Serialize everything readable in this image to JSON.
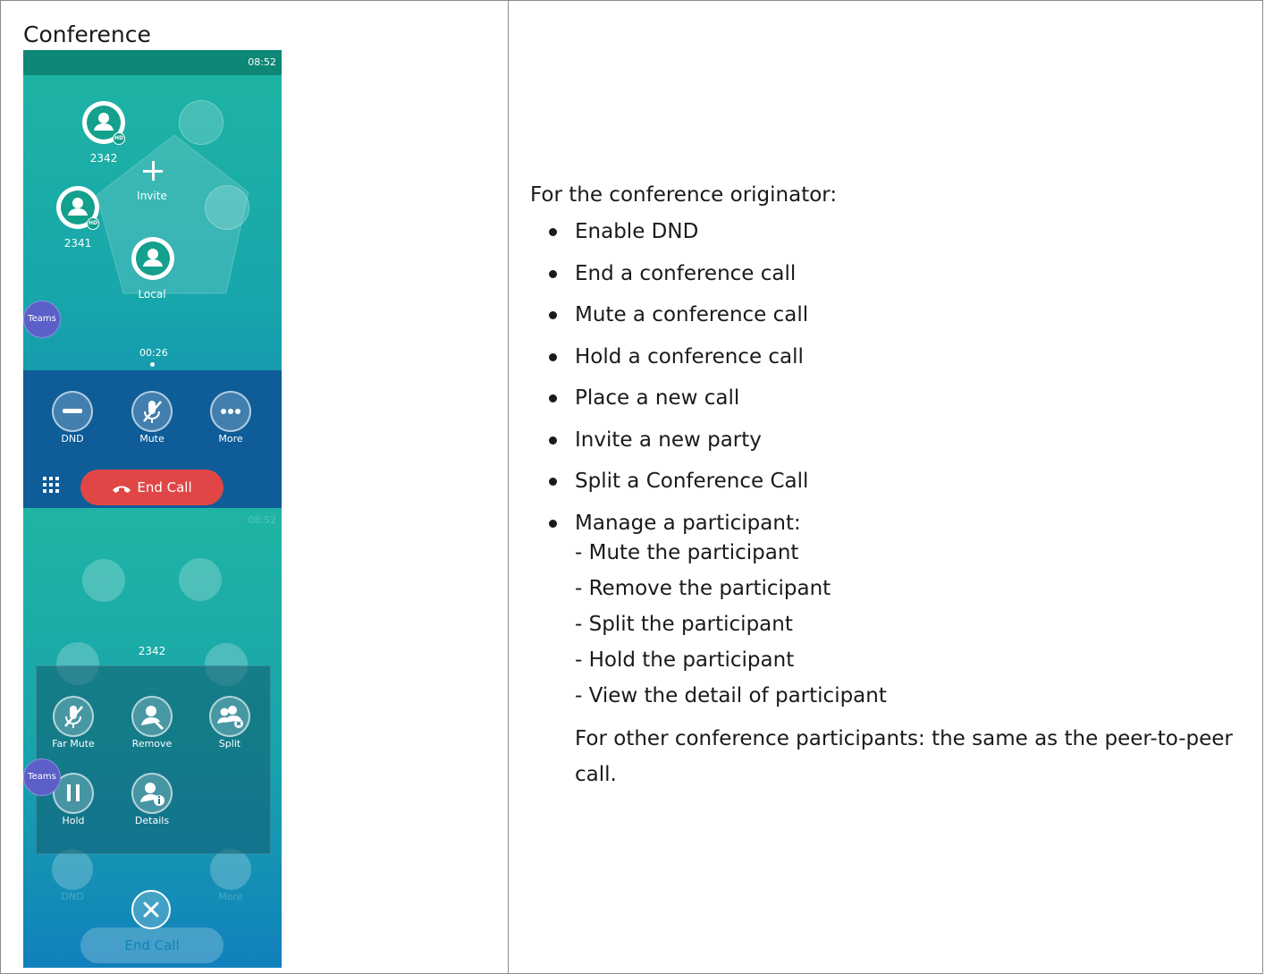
{
  "section_title": "Conference",
  "screen1": {
    "time": "08:52",
    "participants": [
      {
        "name": "2342",
        "badge": "HD"
      },
      {
        "name": "2341",
        "badge": "HD"
      },
      {
        "name": "Local"
      }
    ],
    "invite_label": "Invite",
    "teams_label": "Teams",
    "timer": "00:26",
    "controls": [
      {
        "label": "DND",
        "icon": "minus-icon"
      },
      {
        "label": "Mute",
        "icon": "mic-muted-icon"
      },
      {
        "label": "More",
        "icon": "ellipsis-icon"
      }
    ],
    "end_call_label": "End Call"
  },
  "screen2": {
    "time": "08:52",
    "selected_participant": "2342",
    "teams_label": "Teams",
    "menu": [
      {
        "label": "Far Mute",
        "icon": "mic-muted-icon"
      },
      {
        "label": "Remove",
        "icon": "remove-user-icon"
      },
      {
        "label": "Split",
        "icon": "split-users-icon"
      },
      {
        "label": "Hold",
        "icon": "pause-icon"
      },
      {
        "label": "Details",
        "icon": "user-info-icon"
      }
    ],
    "faded_labels": {
      "dnd": "DND",
      "more": "More",
      "end_call": "End Call",
      "name": "2342"
    }
  },
  "right": {
    "intro": "For the conference originator:",
    "bullets": [
      "Enable DND",
      "End a conference call",
      "Mute a conference call",
      "Hold a conference call",
      "Place a new call",
      "Invite a new party",
      "Split a Conference Call",
      "Manage a participant:"
    ],
    "sub_items": [
      "- Mute the participant",
      "- Remove the participant",
      "- Split the participant",
      "- Hold the participant",
      "- View the detail of participant"
    ],
    "tail": "For other conference participants: the same as the peer-to-peer call."
  }
}
